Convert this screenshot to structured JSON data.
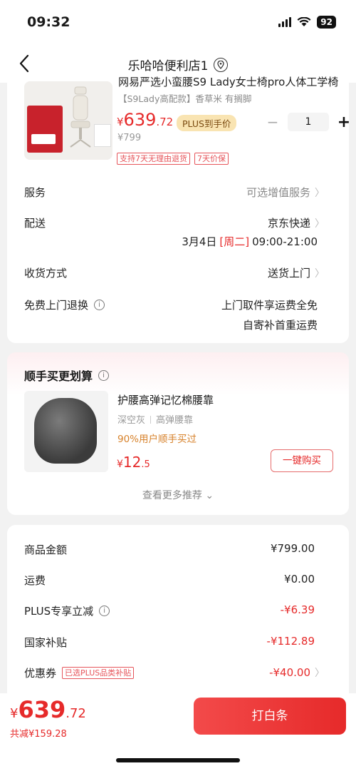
{
  "status": {
    "time": "09:32",
    "battery": "92"
  },
  "nav": {
    "title": "乐哈哈便利店1"
  },
  "product": {
    "title": "网易严选小蛮腰S9 Lady女士椅pro人体工学椅",
    "spec": "【S9Lady高配款】香草米 有搁脚",
    "price_currency": "¥",
    "price_int": "639",
    "price_dec": ".72",
    "plus_badge": "PLUS到手价",
    "quantity": "1",
    "original_price": "¥799",
    "tags": [
      "支持7天无理由退货",
      "7天价保"
    ],
    "thumb_badge": "799"
  },
  "rows": {
    "service": {
      "label": "服务",
      "value": "可选增值服务"
    },
    "delivery": {
      "label": "配送",
      "value": "京东快递",
      "date": "3月4日",
      "weekday": "[周二]",
      "time": "09:00-21:00"
    },
    "receive": {
      "label": "收货方式",
      "value": "送货上门"
    },
    "free_return": {
      "label": "免费上门退换",
      "value1": "上门取件享运费全免",
      "value2": "自寄补首重运费"
    }
  },
  "addon": {
    "section_title": "顺手买更划算",
    "name": "护腰高弹记忆棉腰靠",
    "spec1": "深空灰",
    "spec2": "高弹腰靠",
    "percent": "90%用户顺手买过",
    "price_currency": "¥",
    "price_int": "12",
    "price_dec": ".5",
    "buy_label": "一键购买",
    "more_label": "查看更多推荐"
  },
  "summary": {
    "goods_label": "商品金额",
    "goods_value": "¥799.00",
    "shipping_label": "运费",
    "shipping_value": "¥0.00",
    "plus_label": "PLUS专享立减",
    "plus_value": "-¥6.39",
    "subsidy_label": "国家补贴",
    "subsidy_value": "-¥112.89",
    "coupon_label": "优惠券",
    "coupon_tag": "已选PLUS品类补贴",
    "coupon_value": "-¥40.00"
  },
  "bottom": {
    "price_currency": "¥",
    "price_int": "639",
    "price_dec": ".72",
    "saving": "共减¥159.28",
    "pay_label": "打白条"
  },
  "colors": {
    "accent": "#e62a2a",
    "plus_gold": "#f9e4b2",
    "orange": "#d7822b"
  },
  "icons": [
    "back-icon",
    "location-pin-icon",
    "info-icon",
    "chevron-right-icon",
    "chevron-down-icon",
    "signal-icon",
    "wifi-icon",
    "battery-icon"
  ]
}
